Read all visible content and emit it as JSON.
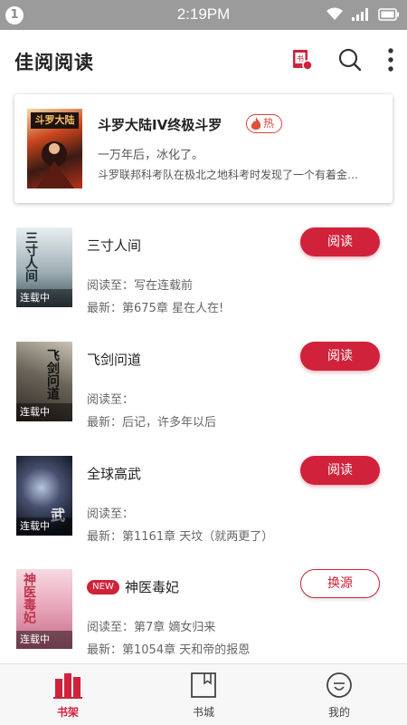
{
  "status_bar": {
    "notification_count": "1",
    "time": "2:19PM"
  },
  "app_bar": {
    "title": "佳阅阅读",
    "icons": [
      "book-gift-icon",
      "search-icon",
      "more-vert-icon"
    ]
  },
  "featured": {
    "cover_title": "斗罗大陆",
    "title": "斗罗大陆IV终极斗罗",
    "badge": "热",
    "subtitle": "一万年后，冰化了。",
    "description": "斗罗联邦科考队在极北之地科考时发现了一个有着金…"
  },
  "books": [
    {
      "title": "三寸人间",
      "cover_text": "三寸人间",
      "status_badge": "连载中",
      "is_new": false,
      "progress": "阅读至：写在连载前",
      "latest": "最新：第675章 星在人在!",
      "action": "阅读"
    },
    {
      "title": "飞剑问道",
      "cover_text": "飞剑问道",
      "status_badge": "连载中",
      "is_new": false,
      "progress": "阅读至：",
      "latest": "最新：后记，许多年以后",
      "action": "阅读"
    },
    {
      "title": "全球高武",
      "cover_text": "武",
      "status_badge": "连载中",
      "is_new": false,
      "progress": "阅读至：",
      "latest": "最新：第1161章 天坟（就两更了）",
      "action": "阅读"
    },
    {
      "title": "神医毒妃",
      "cover_text": "神医毒妃",
      "status_badge": "连载中",
      "is_new": true,
      "new_label": "NEW",
      "progress": "阅读至：第7章 嫡女归来",
      "latest": "最新：第1054章 天和帝的报恩",
      "action": "换源"
    }
  ],
  "bottom_nav": [
    {
      "label": "书架",
      "icon": "bookshelf-icon",
      "active": true
    },
    {
      "label": "书城",
      "icon": "bookstore-icon",
      "active": false
    },
    {
      "label": "我的",
      "icon": "profile-icon",
      "active": false
    }
  ],
  "colors": {
    "accent": "#d0223a",
    "status_bar": "#9b9b9b"
  }
}
